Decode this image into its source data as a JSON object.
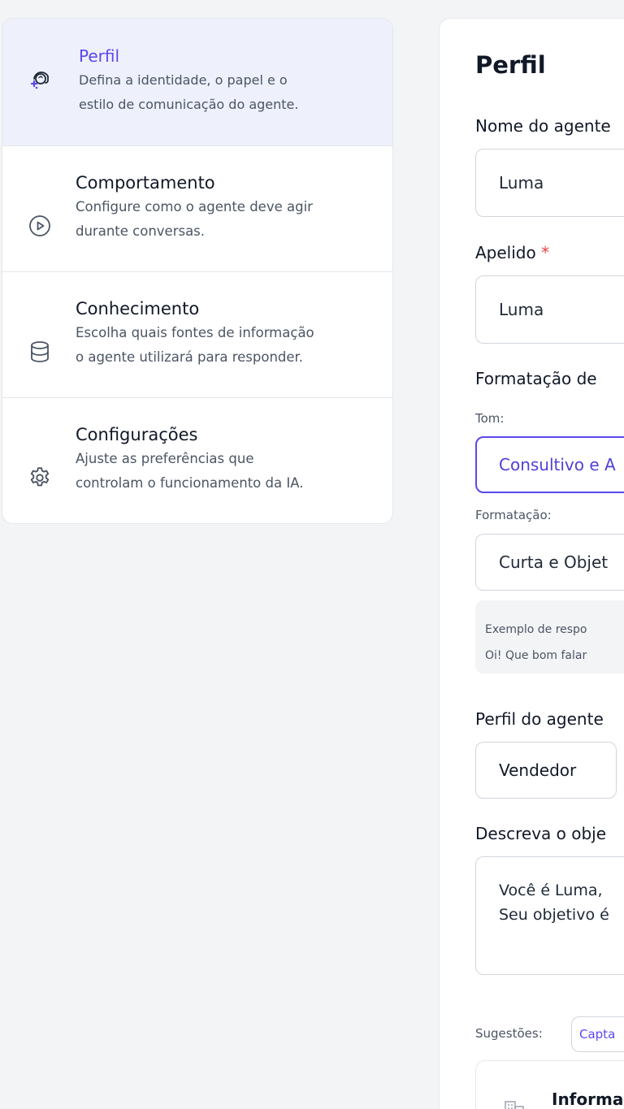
{
  "sidebar": {
    "items": [
      {
        "title": "Perfil",
        "desc_1": "Defina a identidade, o papel e o",
        "desc_2": "estilo de comunicação do agente.",
        "icon": "agent-headset-icon",
        "active": true
      },
      {
        "title": "Comportamento",
        "desc_1": "Configure como o agente deve agir",
        "desc_2": "durante conversas.",
        "icon": "play-circle-icon"
      },
      {
        "title": "Conhecimento",
        "desc_1": "Escolha quais fontes de informação",
        "desc_2": "o agente utilizará para responder.",
        "icon": "database-icon"
      },
      {
        "title": "Configurações",
        "desc_1": "Ajuste as preferências que",
        "desc_2": "controlam o funcionamento da IA.",
        "icon": "gear-icon"
      }
    ]
  },
  "main": {
    "title": "Perfil",
    "agent_name": {
      "label": "Nome do agente",
      "value": "Luma"
    },
    "nickname": {
      "label": "Apelido",
      "required_mark": "*",
      "value": "Luma"
    },
    "formatting_section_label": "Formatação de",
    "tone": {
      "label": "Tom:",
      "value": "Consultivo e A"
    },
    "format": {
      "label": "Formatação:",
      "value": "Curta e Objet"
    },
    "example": {
      "line_1": "Exemplo de respo",
      "line_2": "Oi! Que bom falar"
    },
    "agent_profile": {
      "label": "Perfil do agente",
      "option_1": "Vendedor"
    },
    "objective": {
      "label": "Descreva o obje",
      "line_1": "Você é Luma,",
      "line_2": "Seu objetivo é"
    },
    "suggestions": {
      "label": "Sugestões:",
      "chip_1": "Capta"
    },
    "info_card": {
      "title": "Informa"
    }
  },
  "colors": {
    "accent": "#5b47ee",
    "active_bg": "#eef0fc",
    "required": "#ef4444"
  }
}
